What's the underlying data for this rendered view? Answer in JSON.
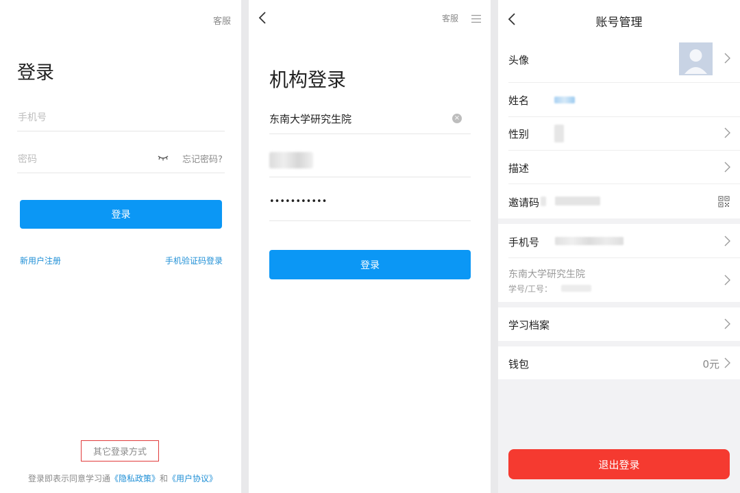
{
  "login": {
    "support_label": "客服",
    "title": "登录",
    "phone_placeholder": "手机号",
    "password_placeholder": "密码",
    "forgot_password": "忘记密码?",
    "login_button": "登录",
    "register_link": "新用户注册",
    "sms_login_link": "手机验证码登录",
    "other_methods": "其它登录方式",
    "agreement_prefix": "登录即表示同意学习通",
    "privacy_policy": "《隐私政策》",
    "agreement_and": "和",
    "user_agreement": "《用户协议》"
  },
  "org_login": {
    "support_label": "客服",
    "title": "机构登录",
    "org_value": "东南大学研究生院",
    "password_mask": "•••••••••••",
    "login_button": "登录"
  },
  "account": {
    "title": "账号管理",
    "avatar_label": "头像",
    "name_label": "姓名",
    "gender_label": "性别",
    "description_label": "描述",
    "invite_label": "邀请码",
    "phone_label": "手机号",
    "org_name": "东南大学研究生院",
    "student_id_label": "学号/工号：",
    "records_label": "学习档案",
    "wallet_label": "钱包",
    "wallet_value": "0元",
    "logout_button": "退出登录"
  },
  "colors": {
    "primary_blue": "#0b97f5",
    "link_blue": "#1f8fd6",
    "logout_red": "#f53a30",
    "highlight_red": "#e03a3a"
  }
}
